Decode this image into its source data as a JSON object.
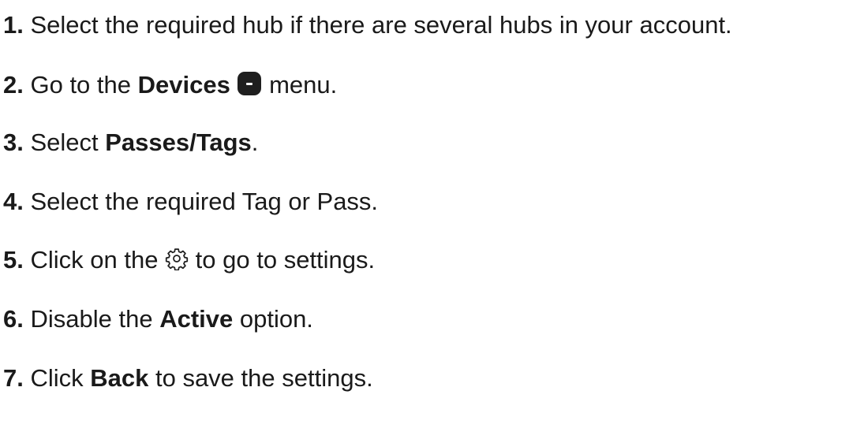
{
  "steps": [
    {
      "num": "1.",
      "text": " Select the required hub if there are several hubs in your account."
    },
    {
      "num": "2.",
      "pre": " Go to the ",
      "bold": "Devices",
      "post": " menu.",
      "icon": "devices-icon"
    },
    {
      "num": "3.",
      "pre": " Select ",
      "bold": "Passes/Tags",
      "post": "."
    },
    {
      "num": "4.",
      "text": " Select the required Tag or Pass."
    },
    {
      "num": "5.",
      "pre": " Click on the ",
      "post": " to go to settings.",
      "icon": "gear-icon"
    },
    {
      "num": "6.",
      "pre": " Disable the ",
      "bold": "Active",
      "post": " option."
    },
    {
      "num": "7.",
      "pre": " Click ",
      "bold": "Back",
      "post": " to save the settings."
    }
  ],
  "colors": {
    "text": "#1a1a1a",
    "icon_fill": "#1f1f1f"
  }
}
